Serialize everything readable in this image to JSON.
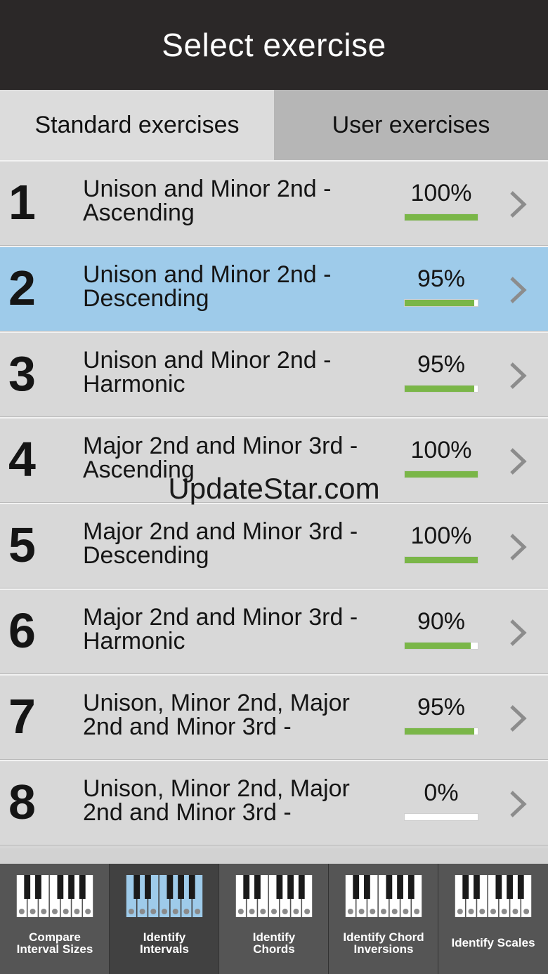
{
  "header": {
    "title": "Select exercise"
  },
  "tabs": [
    {
      "label": "Standard exercises"
    },
    {
      "label": "User exercises"
    }
  ],
  "exercises": [
    {
      "number": "1",
      "title": "Unison and Minor 2nd -\nAscending",
      "percent_label": "100%",
      "progress": 1.0
    },
    {
      "number": "2",
      "title": "Unison and Minor 2nd -\nDescending",
      "percent_label": "95%",
      "progress": 0.95
    },
    {
      "number": "3",
      "title": "Unison and Minor 2nd -\nHarmonic",
      "percent_label": "95%",
      "progress": 0.95
    },
    {
      "number": "4",
      "title": "Major 2nd and Minor 3rd -\nAscending",
      "percent_label": "100%",
      "progress": 1.0
    },
    {
      "number": "5",
      "title": "Major 2nd and Minor 3rd -\nDescending",
      "percent_label": "100%",
      "progress": 1.0
    },
    {
      "number": "6",
      "title": "Major 2nd and Minor 3rd -\nHarmonic",
      "percent_label": "90%",
      "progress": 0.9
    },
    {
      "number": "7",
      "title": "Unison, Minor 2nd, Major\n2nd and Minor 3rd -",
      "percent_label": "95%",
      "progress": 0.95
    },
    {
      "number": "8",
      "title": "Unison, Minor 2nd, Major\n2nd and Minor 3rd -",
      "percent_label": "0%",
      "progress": 0.0
    }
  ],
  "selected_exercise": "2",
  "watermark": "UpdateStar.com",
  "bottom_nav": [
    {
      "label": "Compare\nInterval Sizes",
      "icon": "keyboard-icon"
    },
    {
      "label": "Identify\nIntervals",
      "icon": "keyboard-icon"
    },
    {
      "label": "Identify\nChords",
      "icon": "keyboard-icon"
    },
    {
      "label": "Identify Chord\nInversions",
      "icon": "keyboard-icon"
    },
    {
      "label": "Identify Scales",
      "icon": "keyboard-icon"
    }
  ],
  "active_nav": "Identify\nIntervals",
  "colors": {
    "header_bg": "#2b2828",
    "selected_row": "#9ecbea",
    "progress_fill": "#7ab648",
    "active_keyboard": "#9ecbea"
  }
}
